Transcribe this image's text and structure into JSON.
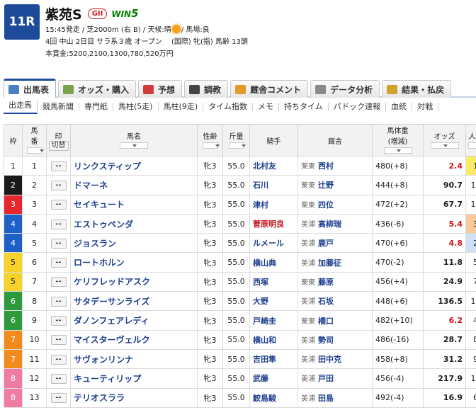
{
  "race": {
    "number": "11R",
    "name": "紫苑S",
    "grade": "GII",
    "win5_prefix": "WIN",
    "win5_suffix": "5",
    "line1_left": "15:45発走 / 芝2000m (右 B) / 天候:晴",
    "line1_right": "/ 馬場:良",
    "line2": "4回 中山 2日目 サラ系３歳 オープン　 (国際) 牝(指) 馬齢 13頭",
    "line3": "本賞金:5200,2100,1300,780,520万円"
  },
  "tabs": [
    {
      "label": "出馬表",
      "icon": "table-icon",
      "color": "#4a7fc4"
    },
    {
      "label": "オッズ・購入",
      "icon": "ticket-icon",
      "color": "#7aa24a"
    },
    {
      "label": "予想",
      "icon": "target-icon",
      "color": "#d23a3a"
    },
    {
      "label": "調教",
      "icon": "stopwatch-icon",
      "color": "#444444"
    },
    {
      "label": "厩舎コメント",
      "icon": "stable-icon",
      "color": "#e39a2a"
    },
    {
      "label": "データ分析",
      "icon": "chart-icon",
      "color": "#8a8a8a"
    },
    {
      "label": "結果・払戻",
      "icon": "coins-icon",
      "color": "#d1a22c"
    }
  ],
  "subnav": [
    "出走馬",
    "競馬新聞",
    "専門紙",
    "馬柱(5走)",
    "馬柱(9走)",
    "タイム指数",
    "メモ",
    "持ちタイム",
    "パドック速報",
    "血統",
    "対戦"
  ],
  "columns": {
    "waku": "枠",
    "umaban_1": "馬",
    "umaban_2": "番",
    "mark": "印",
    "mark_toggle": "切替",
    "horse": "馬名",
    "sex_age": "性齢",
    "weight": "斤量",
    "jockey": "騎手",
    "trainer": "厩舎",
    "body_1": "馬体重",
    "body_2": "(増減)",
    "odds": "オッズ",
    "pop": "人気"
  },
  "mark_symbol": "--",
  "rows": [
    {
      "waku": "1",
      "num": "1",
      "horse": "リンクスティップ",
      "sex_age": "牝3",
      "weight": "55.0",
      "jockey": "北村友",
      "jockey_red": false,
      "region": "栗東",
      "trainer": "西村",
      "body": "480(+8)",
      "odds": "2.4",
      "odds_red": true,
      "pop": "1"
    },
    {
      "waku": "2",
      "num": "2",
      "horse": "ドマーネ",
      "sex_age": "牝3",
      "weight": "55.0",
      "jockey": "石川",
      "jockey_red": false,
      "region": "栗東",
      "trainer": "辻野",
      "body": "444(+8)",
      "odds": "90.7",
      "odds_red": false,
      "pop": "11"
    },
    {
      "waku": "3",
      "num": "3",
      "horse": "セイキュート",
      "sex_age": "牝3",
      "weight": "55.0",
      "jockey": "津村",
      "jockey_red": false,
      "region": "栗東",
      "trainer": "四位",
      "body": "472(+2)",
      "odds": "67.7",
      "odds_red": false,
      "pop": "10"
    },
    {
      "waku": "4",
      "num": "4",
      "horse": "エストゥペンダ",
      "sex_age": "牝3",
      "weight": "55.0",
      "jockey": "菅原明良",
      "jockey_red": true,
      "region": "美浦",
      "trainer": "高柳瑞",
      "body": "436(-6)",
      "odds": "5.4",
      "odds_red": true,
      "pop": "3"
    },
    {
      "waku": "4",
      "num": "5",
      "horse": "ジョスラン",
      "sex_age": "牝3",
      "weight": "55.0",
      "jockey": "ルメール",
      "jockey_red": false,
      "region": "美浦",
      "trainer": "鹿戸",
      "body": "470(+6)",
      "odds": "4.8",
      "odds_red": true,
      "pop": "2"
    },
    {
      "waku": "5",
      "num": "6",
      "horse": "ロートホルン",
      "sex_age": "牝3",
      "weight": "55.0",
      "jockey": "横山典",
      "jockey_red": false,
      "region": "美浦",
      "trainer": "加藤征",
      "body": "470(-2)",
      "odds": "11.8",
      "odds_red": false,
      "pop": "5"
    },
    {
      "waku": "5",
      "num": "7",
      "horse": "ケリフレッドアスク",
      "sex_age": "牝3",
      "weight": "55.0",
      "jockey": "西塚",
      "jockey_red": false,
      "region": "栗東",
      "trainer": "藤原",
      "body": "456(+4)",
      "odds": "24.9",
      "odds_red": false,
      "pop": "7"
    },
    {
      "waku": "6",
      "num": "8",
      "horse": "サタデーサンライズ",
      "sex_age": "牝3",
      "weight": "55.0",
      "jockey": "大野",
      "jockey_red": false,
      "region": "美浦",
      "trainer": "石坂",
      "body": "448(+6)",
      "odds": "136.5",
      "odds_red": false,
      "pop": "12"
    },
    {
      "waku": "6",
      "num": "9",
      "horse": "ダノンフェアレディ",
      "sex_age": "牝3",
      "weight": "55.0",
      "jockey": "戸崎圭",
      "jockey_red": false,
      "region": "栗東",
      "trainer": "橋口",
      "body": "482(+10)",
      "odds": "6.2",
      "odds_red": true,
      "pop": "4"
    },
    {
      "waku": "7",
      "num": "10",
      "horse": "マイスターヴェルク",
      "sex_age": "牝3",
      "weight": "55.0",
      "jockey": "横山和",
      "jockey_red": false,
      "region": "美浦",
      "trainer": "勢司",
      "body": "486(-16)",
      "odds": "28.7",
      "odds_red": false,
      "pop": "8"
    },
    {
      "waku": "7",
      "num": "11",
      "horse": "サヴォンリンナ",
      "sex_age": "牝3",
      "weight": "55.0",
      "jockey": "吉田隼",
      "jockey_red": false,
      "region": "美浦",
      "trainer": "田中克",
      "body": "458(+8)",
      "odds": "31.2",
      "odds_red": false,
      "pop": "9"
    },
    {
      "waku": "8",
      "num": "12",
      "horse": "キューティリップ",
      "sex_age": "牝3",
      "weight": "55.0",
      "jockey": "武藤",
      "jockey_red": false,
      "region": "美浦",
      "trainer": "戸田",
      "body": "456(-4)",
      "odds": "217.9",
      "odds_red": false,
      "pop": "13"
    },
    {
      "waku": "8",
      "num": "13",
      "horse": "テリオスララ",
      "sex_age": "牝3",
      "weight": "55.0",
      "jockey": "鮫島駿",
      "jockey_red": false,
      "region": "美浦",
      "trainer": "田島",
      "body": "492(-4)",
      "odds": "16.9",
      "odds_red": false,
      "pop": "6"
    }
  ],
  "waku_colors": {
    "1": {
      "bg": "#ffffff",
      "fg": "#222222"
    },
    "2": {
      "bg": "#1a1a1a",
      "fg": "#ffffff"
    },
    "3": {
      "bg": "#e8262d",
      "fg": "#ffffff"
    },
    "4": {
      "bg": "#1e60c8",
      "fg": "#ffffff"
    },
    "5": {
      "bg": "#f7d22a",
      "fg": "#222222"
    },
    "6": {
      "bg": "#2d9a3e",
      "fg": "#ffffff"
    },
    "7": {
      "bg": "#f28a1c",
      "fg": "#ffffff"
    },
    "8": {
      "bg": "#f07ca6",
      "fg": "#ffffff"
    }
  },
  "pop_colors": {
    "1": "#fbe96a",
    "2": "#cfe0f8",
    "3": "#f7c99a"
  }
}
